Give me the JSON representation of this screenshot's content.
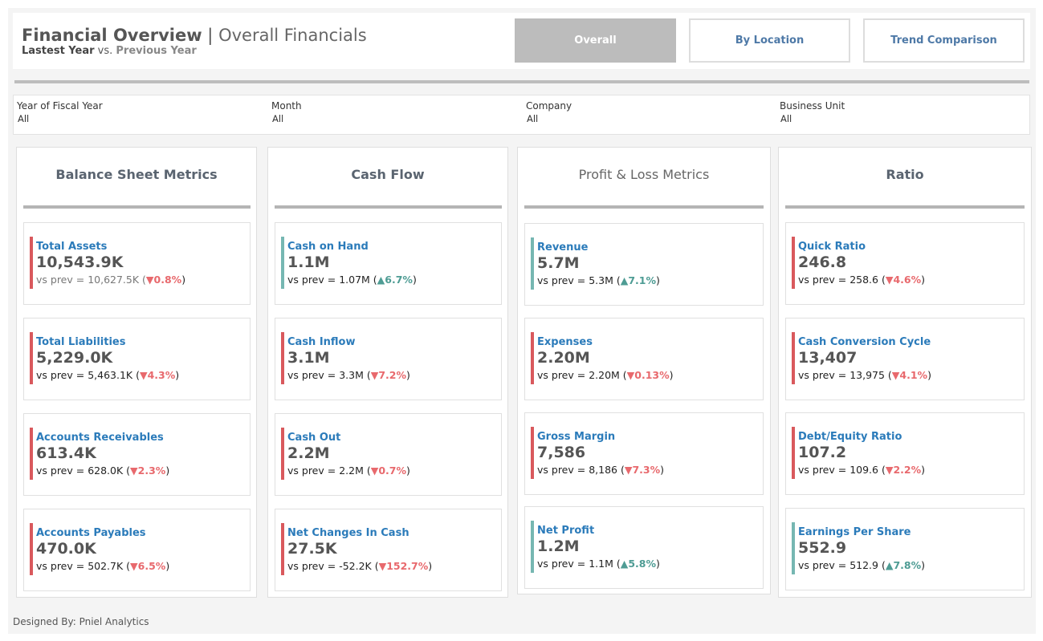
{
  "header": {
    "title_main": "Financial Overview",
    "title_sep": " | ",
    "title_sub": "Overall Financials",
    "subtitle_current": "Lastest Year",
    "subtitle_vs": " vs. ",
    "subtitle_previous": "Previous Year"
  },
  "nav": {
    "overall": "Overall",
    "by_location": "By Location",
    "trend_comparison": "Trend Comparison"
  },
  "filters": [
    {
      "label": "Year of Fiscal Year",
      "value": "All"
    },
    {
      "label": "Month",
      "value": "All"
    },
    {
      "label": "Company",
      "value": "All"
    },
    {
      "label": "Business Unit",
      "value": "All"
    }
  ],
  "panels": {
    "balance": {
      "title": "Balance Sheet Metrics",
      "cards": [
        {
          "name": "Total Assets",
          "value": "10,543.9K",
          "prev": "vs prev = 10,627.5K (",
          "delta": "▼0.8%",
          "close": ")"
        },
        {
          "name": "Total Liabilities",
          "value": "5,229.0K",
          "prev": "vs prev = 5,463.1K (",
          "delta": "▼4.3%",
          "close": ")"
        },
        {
          "name": "Accounts Receivables",
          "value": "613.4K",
          "prev": "vs prev = 628.0K (",
          "delta": "▼2.3%",
          "close": ")"
        },
        {
          "name": "Accounts Payables",
          "value": "470.0K",
          "prev": "vs prev = 502.7K (",
          "delta": "▼6.5%",
          "close": ")"
        }
      ]
    },
    "cashflow": {
      "title": "Cash Flow",
      "cards": [
        {
          "name": "Cash on Hand",
          "value": "1.1M",
          "prev": "vs prev = 1.07M (",
          "delta": "▲6.7%",
          "close": ")"
        },
        {
          "name": "Cash Inflow",
          "value": "3.1M",
          "prev": "vs prev = 3.3M (",
          "delta": "▼7.2%",
          "close": ")"
        },
        {
          "name": "Cash Out",
          "value": "2.2M",
          "prev": "vs prev = 2.2M (",
          "delta": "▼0.7%",
          "close": ")"
        },
        {
          "name": "Net Changes In Cash",
          "value": "27.5K",
          "prev": "vs prev = -52.2K (",
          "delta": "▼152.7%",
          "close": ")"
        }
      ]
    },
    "pnl": {
      "title": "Profit & Loss Metrics",
      "cards": [
        {
          "name": "Revenue",
          "value": "5.7M",
          "prev": "vs prev = 5.3M (",
          "delta": "▲7.1%",
          "close": ")"
        },
        {
          "name": "Expenses",
          "value": "2.20M",
          "prev": "vs prev = 2.20M (",
          "delta": "▼0.13%",
          "close": ")"
        },
        {
          "name": "Gross Margin",
          "value": "7,586",
          "prev": "vs prev = 8,186 (",
          "delta": "▼7.3%",
          "close": ")"
        },
        {
          "name": "Net Profit",
          "value": "1.2M",
          "prev": "vs prev = 1.1M (",
          "delta": "▲5.8%",
          "close": ")"
        }
      ]
    },
    "ratio": {
      "title": "Ratio",
      "cards": [
        {
          "name": "Quick Ratio",
          "value": "246.8",
          "prev": "vs prev = 258.6 (",
          "delta": "▼4.6%",
          "close": ")"
        },
        {
          "name": "Cash Conversion Cycle",
          "value": "13,407",
          "prev": "vs prev = 13,975 (",
          "delta": "▼4.1%",
          "close": ")"
        },
        {
          "name": "Debt/Equity Ratio",
          "value": "107.2",
          "prev": "vs prev = 109.6 (",
          "delta": "▼2.2%",
          "close": ")"
        },
        {
          "name": "Earnings Per Share",
          "value": "552.9",
          "prev": "vs prev = 512.9 (",
          "delta": "▲7.8%",
          "close": ")"
        }
      ]
    }
  },
  "colors": {
    "negative": "#e8696d",
    "positive": "#4e9c94",
    "bar_red": "#d9595d",
    "bar_teal": "#76b7b2",
    "metric_name": "#2b7bba",
    "nav_active_bg": "#bcbcbc",
    "nav_text": "#4e79a7"
  },
  "footer": {
    "credit": "Designed By: Pniel Analytics"
  }
}
